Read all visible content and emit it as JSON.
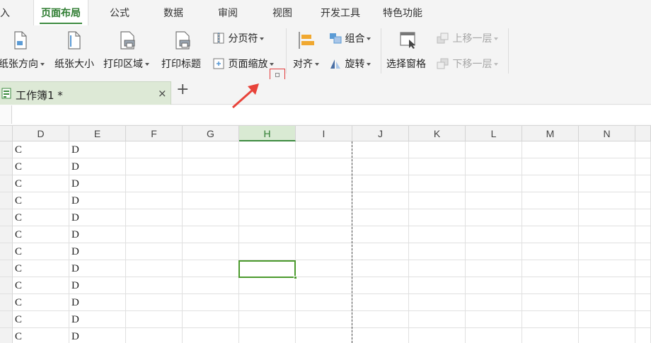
{
  "menu_tabs": [
    {
      "label": "插入",
      "visible_text": "插入"
    },
    {
      "label": "页面布局",
      "active": true
    },
    {
      "label": "公式"
    },
    {
      "label": "数据"
    },
    {
      "label": "审阅"
    },
    {
      "label": "视图"
    },
    {
      "label": "开发工具"
    },
    {
      "label": "特色功能"
    }
  ],
  "ribbon": {
    "orientation": "纸张方向",
    "paper_size": "纸张大小",
    "print_area": "打印区域",
    "print_titles": "打印标题",
    "page_break": "分页符",
    "page_zoom": "页面缩放",
    "align": "对齐",
    "group": "组合",
    "rotate": "旋转",
    "selection_pane": "选择窗格",
    "bring_forward": "上移一层",
    "send_backward": "下移一层"
  },
  "workbook": {
    "tab_name": "工作簿1 *",
    "close_glyph": "×",
    "add_glyph": "+"
  },
  "formula_bar": {
    "value": ""
  },
  "grid": {
    "columns": [
      "D",
      "E",
      "F",
      "G",
      "H",
      "I",
      "J",
      "K",
      "L",
      "M",
      "N"
    ],
    "selected_column": "H",
    "rows": [
      [
        "C",
        "D"
      ],
      [
        "C",
        "D"
      ],
      [
        "C",
        "D"
      ],
      [
        "C",
        "D"
      ],
      [
        "C",
        "D"
      ],
      [
        "C",
        "D"
      ],
      [
        "C",
        "D"
      ],
      [
        "C",
        "D"
      ],
      [
        "C",
        "D"
      ],
      [
        "C",
        "D"
      ],
      [
        "C",
        "D"
      ],
      [
        "C",
        "D"
      ]
    ]
  },
  "colors": {
    "accent": "#3d8b40",
    "highlight_box": "#e23b3b",
    "annotation_arrow": "#e8433a"
  }
}
